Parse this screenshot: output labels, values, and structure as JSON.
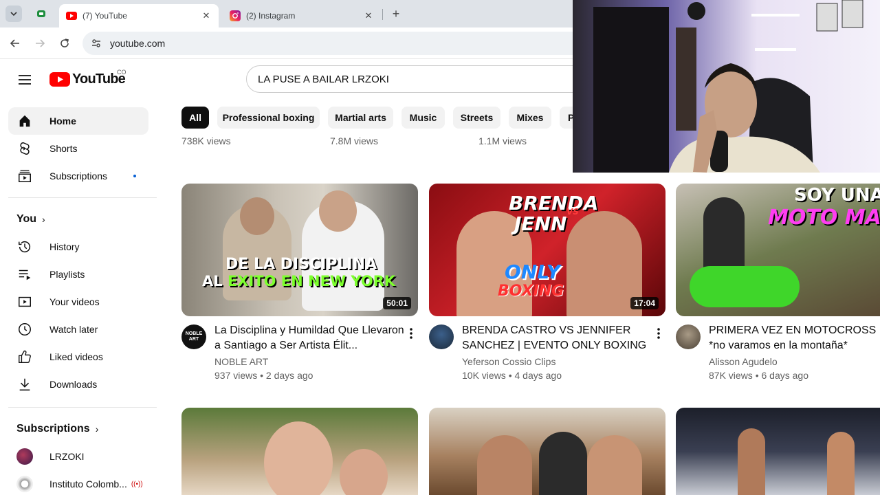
{
  "browser": {
    "tabs": [
      {
        "label": "(7) YouTube",
        "active": true
      },
      {
        "label": "(2) Instagram",
        "active": false
      }
    ],
    "url": "youtube.com"
  },
  "masthead": {
    "logo_text": "YouTube",
    "country_code": "CO",
    "search_query": "LA PUSE A BAILAR LRZOKI"
  },
  "sidebar": {
    "main": [
      {
        "label": "Home",
        "icon": "home-icon"
      },
      {
        "label": "Shorts",
        "icon": "shorts-icon"
      },
      {
        "label": "Subscriptions",
        "icon": "subscriptions-icon"
      }
    ],
    "you_header": "You",
    "you_items": [
      {
        "label": "History",
        "icon": "history-icon"
      },
      {
        "label": "Playlists",
        "icon": "playlists-icon"
      },
      {
        "label": "Your videos",
        "icon": "your-videos-icon"
      },
      {
        "label": "Watch later",
        "icon": "watch-later-icon"
      },
      {
        "label": "Liked videos",
        "icon": "liked-videos-icon"
      },
      {
        "label": "Downloads",
        "icon": "downloads-icon"
      }
    ],
    "subscriptions_header": "Subscriptions",
    "subscriptions": [
      {
        "label": "LRZOKI"
      },
      {
        "label": "Instituto Colomb..."
      }
    ]
  },
  "chips": [
    "All",
    "Professional boxing",
    "Martial arts",
    "Music",
    "Streets",
    "Mixes",
    "P"
  ],
  "previous_row_views": [
    "738K views",
    "7.8M views",
    "1.1M views"
  ],
  "videos": [
    {
      "title": "La Disciplina y Humildad Que Llevaron a Santiago a Ser Artista Élit...",
      "channel": "NOBLE ART",
      "avatar_text": "NOBLE ART",
      "stats": "937 views • 2 days ago",
      "duration": "50:01",
      "thumb_line1": "DE LA DISCIPLINA",
      "thumb_line2a": "AL ",
      "thumb_line2b": "EXITO EN NEW YORK"
    },
    {
      "title": "BRENDA CASTRO VS JENNIFER SANCHEZ | EVENTO ONLY BOXING |...",
      "channel": "Yeferson Cossio Clips",
      "stats": "10K views • 4 days ago",
      "duration": "17:04",
      "thumb_line1": "BRENDA",
      "thumb_vs": "VS",
      "thumb_line2": "JENN",
      "thumb_only": "ONLY",
      "thumb_boxing": "BOXING"
    },
    {
      "title": "PRIMERA VEZ EN MOTOCROSS *no varamos en la montaña*",
      "channel": "Alisson Agudelo",
      "stats": "87K views • 6 days ago",
      "thumb_line1": "SOY UNA",
      "thumb_line2": "MOTO MA"
    }
  ]
}
